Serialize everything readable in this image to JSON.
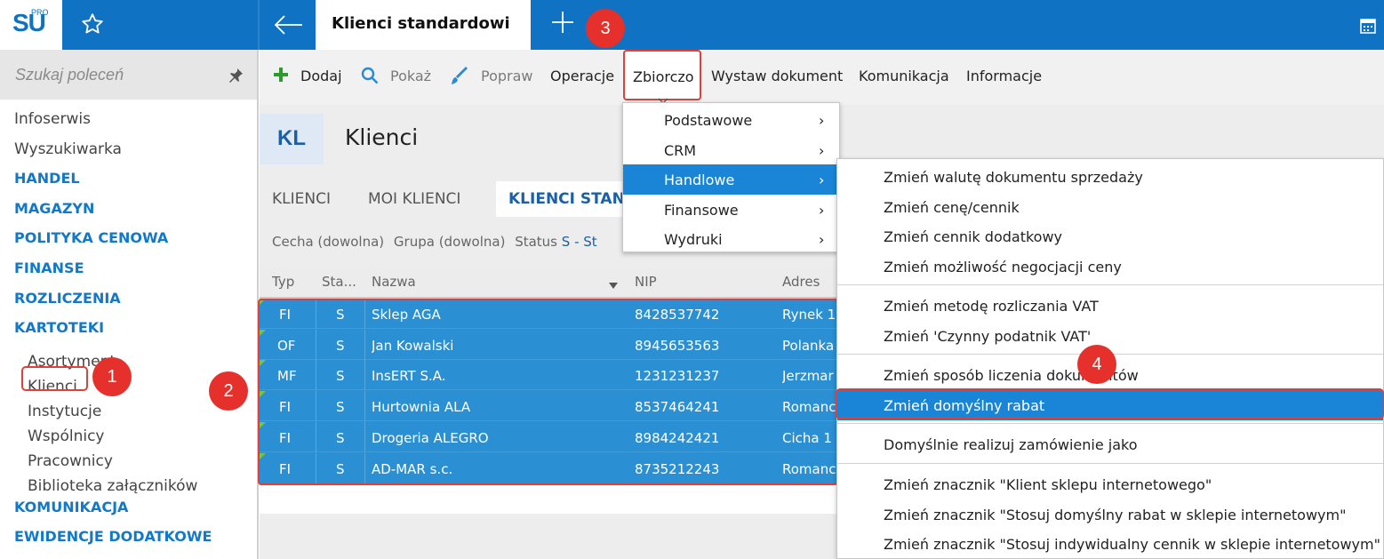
{
  "app": {
    "logo_text": "SU",
    "logo_pro": "PRO",
    "active_tab": "Klienci standardowi"
  },
  "sidebar": {
    "search_placeholder": "Szukaj poleceń",
    "items": [
      {
        "label": "Infoserwis",
        "type": "link"
      },
      {
        "label": "Wyszukiwarka",
        "type": "link"
      },
      {
        "label": "HANDEL",
        "type": "section"
      },
      {
        "label": "MAGAZYN",
        "type": "section"
      },
      {
        "label": "POLITYKA CENOWA",
        "type": "section"
      },
      {
        "label": "FINANSE",
        "type": "section"
      },
      {
        "label": "ROZLICZENIA",
        "type": "section"
      },
      {
        "label": "KARTOTEKI",
        "type": "section"
      }
    ],
    "sub_items": [
      "Asortyment",
      "Klienci",
      "Instytucje",
      "Wspólnicy",
      "Pracownicy",
      "Biblioteka załączników"
    ],
    "bottom_items": [
      "KOMUNIKACJA",
      "EWIDENCJE DODATKOWE"
    ]
  },
  "toolbar": {
    "add": "Dodaj",
    "show": "Pokaż",
    "edit": "Popraw",
    "operations": "Operacje",
    "bulk": "Zbiorczo",
    "issue_doc": "Wystaw dokument",
    "communication": "Komunikacja",
    "information": "Informacje"
  },
  "page": {
    "badge": "KL",
    "title": "Klienci",
    "tabs": [
      "KLIENCI",
      "MOI KLIENCI",
      "KLIENCI STAN"
    ],
    "filter_feature": "Cecha (dowolna)",
    "filter_group": "Grupa (dowolna)",
    "filter_status_label": "Status",
    "filter_status_value": "S - St"
  },
  "grid": {
    "columns": [
      "Typ",
      "Sta...",
      "Nazwa",
      "NIP",
      "Adres"
    ],
    "rows": [
      {
        "typ": "FI",
        "status": "S",
        "nazwa": "Sklep AGA",
        "nip": "8428537742",
        "adres": "Rynek 1"
      },
      {
        "typ": "OF",
        "status": "S",
        "nazwa": "Jan Kowalski",
        "nip": "8945653563",
        "adres": "Polanka"
      },
      {
        "typ": "MF",
        "status": "S",
        "nazwa": "InsERT S.A.",
        "nip": "1231231237",
        "adres": "Jerzmar"
      },
      {
        "typ": "FI",
        "status": "S",
        "nazwa": "Hurtownia ALA",
        "nip": "8537464241",
        "adres": "Romanc"
      },
      {
        "typ": "FI",
        "status": "S",
        "nazwa": "Drogeria ALEGRO",
        "nip": "8984242421",
        "adres": "Cicha 1"
      },
      {
        "typ": "FI",
        "status": "S",
        "nazwa": "AD-MAR s.c.",
        "nip": "8735212243",
        "adres": "Romanc"
      }
    ]
  },
  "menu1": {
    "items": [
      "Podstawowe",
      "CRM",
      "Handlowe",
      "Finansowe",
      "Wydruki"
    ],
    "arrow": "›"
  },
  "menu2": {
    "items": [
      "Zmień walutę dokumentu sprzedaży",
      "Zmień cenę/cennik",
      "Zmień cennik dodatkowy",
      "Zmień możliwość negocjacji ceny",
      "Zmień metodę rozliczania VAT",
      "Zmień 'Czynny podatnik VAT'",
      "Zmień sposób liczenia dokumentów",
      "Zmień domyślny rabat",
      "Domyślnie realizuj zamówienie jako",
      "Zmień znacznik \"Klient sklepu internetowego\"",
      "Zmień znacznik \"Stosuj domyślny rabat w sklepie internetowym\"",
      "Zmień znacznik \"Stosuj indywidualny cennik w sklepie internetowym\""
    ]
  },
  "callouts": [
    "1",
    "2",
    "3",
    "4"
  ],
  "colors": {
    "brand_blue": "#0f72c2",
    "selection_blue": "#1a85d6",
    "callout_red": "#e5302b",
    "add_green": "#2e9a2e"
  }
}
